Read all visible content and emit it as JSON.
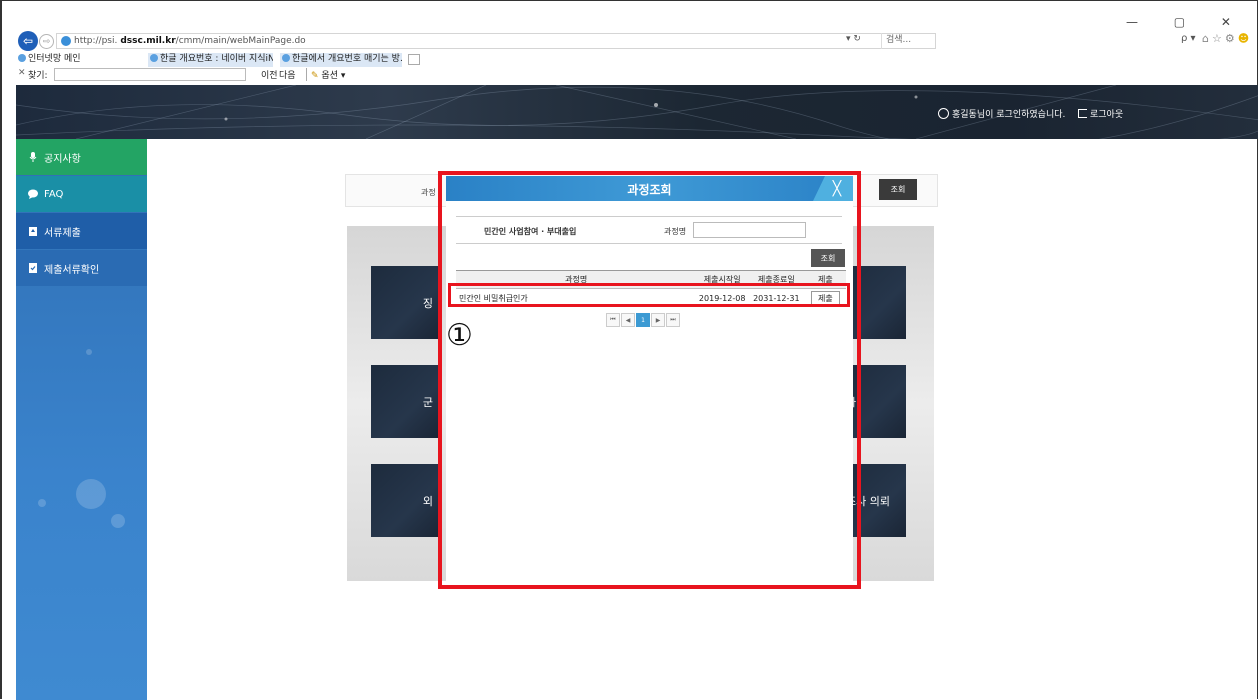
{
  "browser": {
    "url_prefix": "http://psi.",
    "url_host": "dssc.mil.kr",
    "url_path": "/cmm/main/webMainPage.do",
    "refresh_glyph": "▾ ↻",
    "search_placeholder": "검색...",
    "search_go": "ρ ▾",
    "window_controls": "— ▢ ✕",
    "tabs": [
      "인터넷망 메인",
      "한글 개요번호 : 네이버 지식iN...",
      "한글에서 개요번호 매기는 방..."
    ],
    "tab_close": "✕",
    "find_bar": {
      "close": "✕",
      "label": "찾기:",
      "prev": "이전",
      "next": "다음",
      "options": "옵션 ▾"
    }
  },
  "header": {
    "login_message": "홍길동님이 로그인하였습니다.",
    "logout": "로그아웃"
  },
  "sidebar": {
    "items": [
      {
        "label": "공지사항",
        "icon": "microphone-icon"
      },
      {
        "label": "FAQ",
        "icon": "chat-bubble-icon"
      },
      {
        "label": "서류제출",
        "icon": "upload-document-icon"
      },
      {
        "label": "제출서류확인",
        "icon": "check-document-icon"
      }
    ]
  },
  "background": {
    "search_label": "과정",
    "search_button": "조회",
    "cards_left": [
      "징",
      "군",
      "외"
    ],
    "cards_right": [
      "",
      "사",
      "조사 의뢰"
    ]
  },
  "modal": {
    "title": "과정조회",
    "close": "╳",
    "filter_category": "민간인 사업참여 · 부대출입",
    "filter_name_label": "과정명",
    "filter_name_value": "",
    "search_button": "조회",
    "table": {
      "headers": [
        "과정명",
        "제출시작일",
        "제출종료일",
        "제출"
      ],
      "rows": [
        {
          "name": "민간인 비밀취급인가",
          "start": "2019-12-08",
          "end": "2031-12-31",
          "action": "제출"
        }
      ]
    },
    "pager": {
      "first": "⏮",
      "prev": "◀",
      "current": "1",
      "next": "▶",
      "last": "⏭"
    }
  },
  "annotation": {
    "step_marker": "①",
    "highlight_color": "#e8141e"
  }
}
